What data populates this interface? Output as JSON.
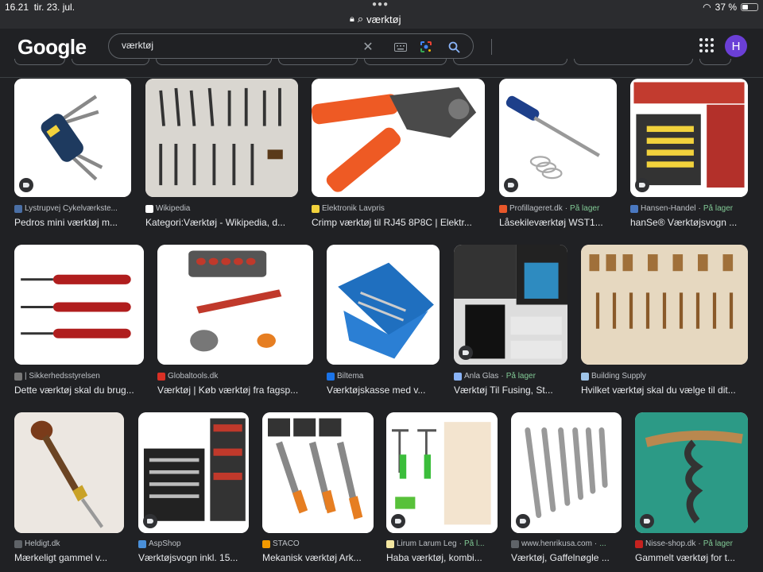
{
  "status": {
    "time": "16.21",
    "date": "tir. 23. jul.",
    "url": "værktøj",
    "battery": "37 %"
  },
  "header": {
    "logo": "Google",
    "search_value": "værktøj",
    "avatar_letter": "H"
  },
  "in_stock_sep": "·",
  "results": [
    {
      "source": "Lystrupvej Cykelværkste...",
      "title": "Pedros mini værktøj m...",
      "stock": "",
      "fav": "#4a6fa5",
      "tag": true
    },
    {
      "source": "Wikipedia",
      "title": "Kategori:Værktøj - Wikipedia, d...",
      "stock": "",
      "fav": "#ffffff",
      "tag": false
    },
    {
      "source": "Elektronik Lavpris",
      "title": "Crimp værktøj til RJ45 8P8C | Elektr...",
      "stock": "",
      "fav": "#f2d23c",
      "tag": false
    },
    {
      "source": "Profillageret.dk",
      "title": "Låsekileværktøj WST1...",
      "stock": "På lager",
      "fav": "#e8572a",
      "tag": true
    },
    {
      "source": "Hansen-Handel",
      "title": "hanSe® Værktøjsvogn ...",
      "stock": "På lager",
      "fav": "#4a78c0",
      "tag": true
    },
    {
      "source": "| Sikkerhedsstyrelsen",
      "title": "Dette værktøj skal du brug...",
      "stock": "",
      "fav": "#777777",
      "tag": false
    },
    {
      "source": "Globaltools.dk",
      "title": "Værktøj | Køb værktøj fra fagsp...",
      "stock": "",
      "fav": "#d93025",
      "tag": false
    },
    {
      "source": "Biltema",
      "title": "Værktøjskasse med v...",
      "stock": "",
      "fav": "#1a73e8",
      "tag": false
    },
    {
      "source": "Anla Glas",
      "title": "Værktøj Til Fusing, St...",
      "stock": "På lager",
      "fav": "#8ab4f8",
      "tag": true
    },
    {
      "source": "Building Supply",
      "title": "Hvilket værktøj skal du vælge til dit...",
      "stock": "",
      "fav": "#9fc5e8",
      "tag": false
    },
    {
      "source": "Heldigt.dk",
      "title": "Mærkeligt gammel v...",
      "stock": "",
      "fav": "#5f6368",
      "tag": false
    },
    {
      "source": "AspShop",
      "title": "Værktøjsvogn inkl. 15...",
      "stock": "",
      "fav": "#4a90d9",
      "tag": true
    },
    {
      "source": "STACO",
      "title": "Mekanisk værktøj Ark...",
      "stock": "",
      "fav": "#f29900",
      "tag": false
    },
    {
      "source": "Lirum Larum Leg",
      "title": "Haba værktøj, kombi...",
      "stock": "På l...",
      "fav": "#f4e7a1",
      "tag": true
    },
    {
      "source": "www.henrikusa.com",
      "title": "Værktøj, Gaffelnøgle ...",
      "stock": "...",
      "fav": "#5f6368",
      "tag": true
    },
    {
      "source": "Nisse-shop.dk",
      "title": "Gammelt værktøj for t...",
      "stock": "På lager",
      "fav": "#c5221f",
      "tag": true
    }
  ]
}
